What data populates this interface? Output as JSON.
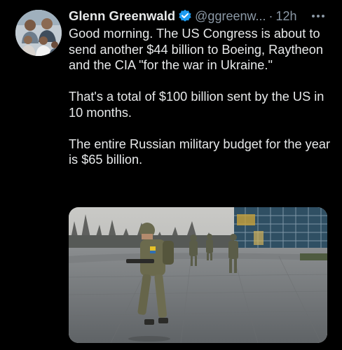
{
  "tweet": {
    "author_name": "Glenn Greenwald",
    "handle": "@ggreenw...",
    "separator": "·",
    "time": "12h",
    "paragraphs": [
      "Good morning. The US Congress is about to send another $44 billion to Boeing, Raytheon and the CIA \"for the war in Ukraine.\"",
      "That's a total of $100 billion sent by the US in 10 months.",
      "The entire Russian military budget for the year is $65 billion."
    ]
  },
  "icons": {
    "verified": "verified-badge-icon",
    "more": "more-options-icon"
  },
  "colors": {
    "background": "#000000",
    "text": "#e7e9ea",
    "secondary_text": "#8b98a5",
    "verified_blue": "#1d9bf0"
  }
}
